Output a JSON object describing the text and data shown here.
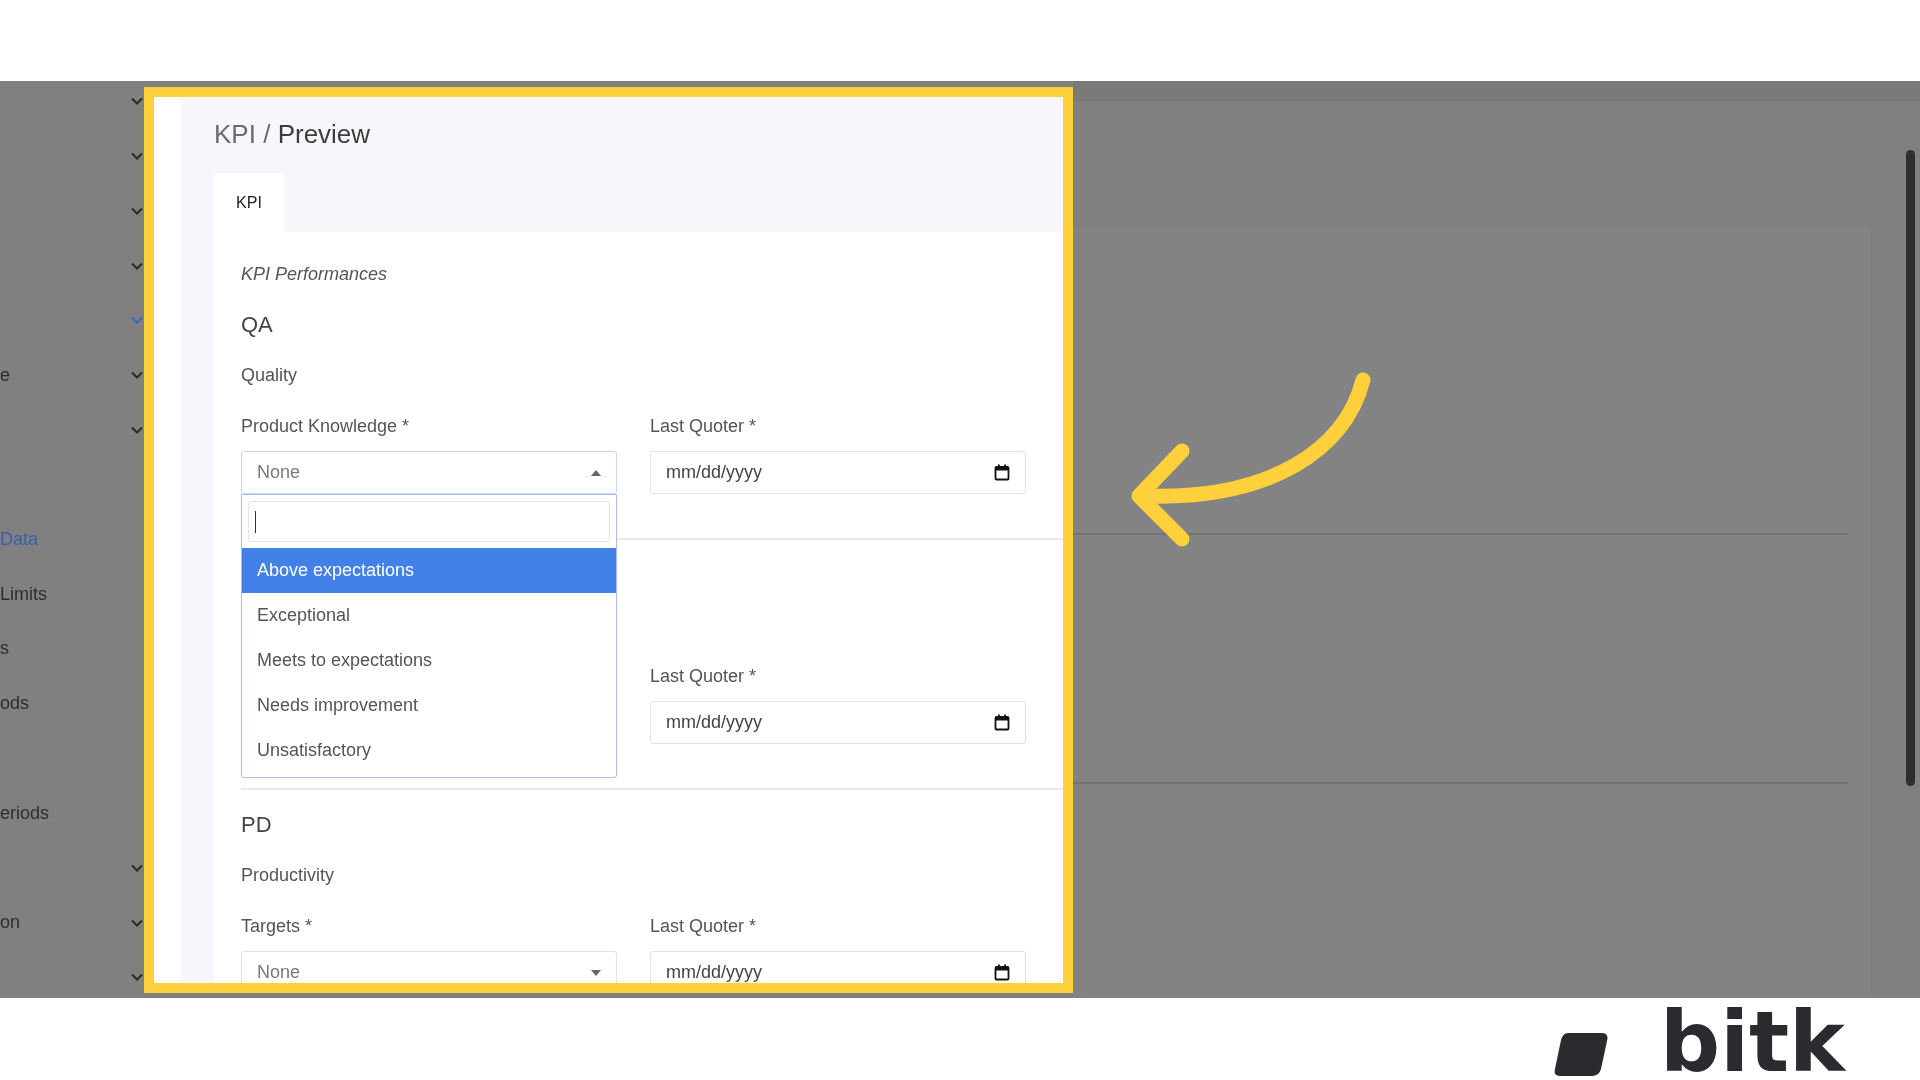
{
  "sidebar": {
    "items": [
      {
        "chevron": true,
        "selected": false
      },
      {
        "chevron": true,
        "selected": false
      },
      {
        "chevron": true,
        "selected": false
      },
      {
        "chevron": true,
        "selected": false
      },
      {
        "chevron": true,
        "selected": true
      },
      {
        "label": "e",
        "chevron": true,
        "selected": false
      },
      {
        "chevron": true,
        "selected": false
      },
      {
        "label": "Data",
        "chevron": false,
        "selected": true,
        "separated": true
      },
      {
        "label": "Limits",
        "chevron": false,
        "selected": false
      },
      {
        "label": "s",
        "chevron": false,
        "selected": false
      },
      {
        "label": "ods",
        "chevron": false,
        "selected": false
      },
      {
        "label": "eriods",
        "chevron": false,
        "selected": false,
        "separated": true
      },
      {
        "chevron": true,
        "selected": false
      },
      {
        "label": "on",
        "chevron": true,
        "selected": false
      },
      {
        "chevron": true,
        "selected": false
      }
    ]
  },
  "breadcrumb": {
    "parent": "KPI",
    "separator": "/",
    "current": "Preview"
  },
  "tabs": [
    {
      "label": "KPI",
      "selected": true
    }
  ],
  "form": {
    "caption": "KPI Performances",
    "sections": [
      {
        "heading": "QA",
        "subheading": "Quality",
        "fields": [
          {
            "kind": "select",
            "label": "Product Knowledge *",
            "value": "None",
            "open": true,
            "options": [
              {
                "label": "Above expectations",
                "selected": true
              },
              {
                "label": "Exceptional",
                "selected": false
              },
              {
                "label": "Meets to expectations",
                "selected": false
              },
              {
                "label": "Needs improvement",
                "selected": false
              },
              {
                "label": "Unsatisfactory",
                "selected": false
              }
            ]
          },
          {
            "kind": "date",
            "label": "Last Quoter *",
            "placeholder": "mm/dd/yyyy"
          }
        ]
      },
      {
        "fields": [
          {
            "kind": "hidden"
          },
          {
            "kind": "date",
            "label": "Last Quoter *",
            "placeholder": "mm/dd/yyyy"
          }
        ]
      },
      {
        "heading": "PD",
        "subheading": "Productivity",
        "fields": [
          {
            "kind": "select",
            "label": "Targets *",
            "value": "None",
            "open": false
          },
          {
            "kind": "date",
            "label": "Last Quoter *",
            "placeholder": "mm/dd/yyyy"
          }
        ]
      }
    ]
  },
  "logo": {
    "text": "bitk"
  }
}
